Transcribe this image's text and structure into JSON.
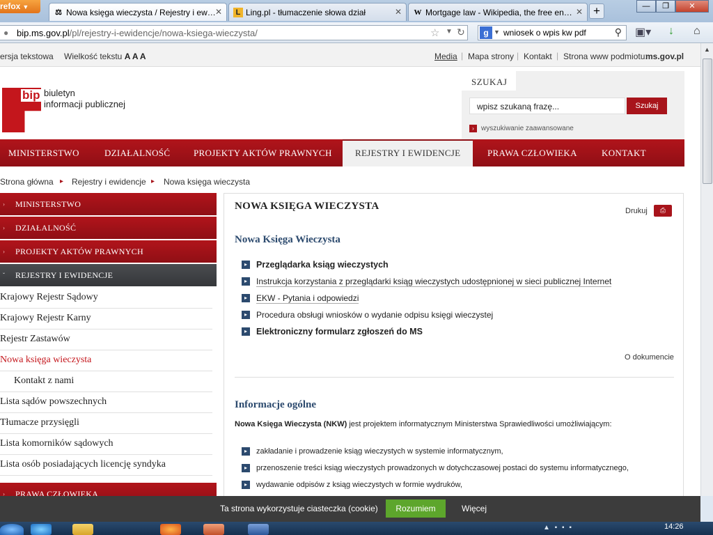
{
  "browser": {
    "menu_button": "refox",
    "tabs": [
      {
        "favicon": "⚖",
        "title": "Nowa księga wieczysta / Rejestry i ew…",
        "active": true
      },
      {
        "favicon": "L",
        "title": "Ling.pl - tłumaczenie słowa dział",
        "active": false
      },
      {
        "favicon": "W",
        "title": "Mortgage law - Wikipedia, the free en…",
        "active": false
      }
    ],
    "new_tab": "+",
    "url": {
      "host": "bip.ms.gov.pl",
      "path": "/pl/rejestry-i-ewidencje/nowa-ksiega-wieczysta/"
    },
    "search_engine": "g",
    "search_query": "wniosek o wpis kw pdf"
  },
  "site": {
    "top": {
      "text_version": "ersja tekstowa",
      "text_size_label": "Wielkość tekstu",
      "text_size_glyphs": "A A A",
      "links": [
        "Media",
        "Mapa strony",
        "Kontakt"
      ],
      "site_label": "Strona www podmiotu:",
      "site_domain": "ms.gov.pl"
    },
    "logo": {
      "mark": "bip",
      "line1": "biuletyn",
      "line2": "informacji publicznej"
    },
    "search": {
      "label": "SZUKAJ",
      "placeholder": "wpisz szukaną frazę...",
      "button": "Szukaj",
      "advanced": "wyszukiwanie zaawansowane"
    },
    "nav": [
      "MINISTERSTWO",
      "DZIAŁALNOŚĆ",
      "PROJEKTY AKTÓW PRAWNYCH",
      "REJESTRY I EWIDENCJE",
      "PRAWA CZŁOWIEKA",
      "KONTAKT"
    ],
    "breadcrumb": [
      "Strona główna",
      "Rejestry i ewidencje",
      "Nowa księga wieczysta"
    ],
    "sidebar": {
      "headers": [
        "MINISTERSTWO",
        "DZIAŁALNOŚĆ",
        "PROJEKTY AKTÓW PRAWNYCH",
        "REJESTRY I EWIDENCJE"
      ],
      "items": [
        "Krajowy Rejestr Sądowy",
        "Krajowy Rejestr Karny",
        "Rejestr Zastawów",
        "Nowa księga wieczysta",
        "Kontakt z nami",
        "Lista sądów powszechnych",
        "Tłumacze przysięgli",
        "Lista komorników sądowych",
        "Lista osób posiadających licencję syndyka"
      ],
      "footer_header": "PRAWA CZŁOWIEKA"
    },
    "content": {
      "title": "NOWA KSIĘGA WIECZYSTA",
      "print": "Drukuj",
      "heading1": "Nowa Księga Wieczysta",
      "links": [
        "Przeglądarka ksiąg wieczystych",
        "Instrukcja korzystania z przeglądarki ksiąg wieczystych udostępnionej w sieci publicznej Internet",
        "EKW - Pytania i odpowiedzi",
        "Procedura obsługi wniosków o wydanie odpisu księgi wieczystej",
        "Elektroniczny formularz zgłoszeń do MS"
      ],
      "about_doc": "O dokumencie",
      "heading2": "Informacje ogólne",
      "intro_bold": "Nowa Księga Wieczysta (NKW)",
      "intro_rest": " jest projektem informatycznym Ministerstwa Sprawiedliwości umożliwiającym:",
      "bullets": [
        "zakładanie i prowadzenie ksiąg wieczystych w systemie informatycznym,",
        "przenoszenie treści ksiąg wieczystych prowadzonych w dotychczasowej postaci do systemu informatycznego,",
        "wydawanie odpisów z ksiąg wieczystych w formie wydruków,"
      ]
    },
    "cookie": {
      "message": "Ta strona wykorzystuje ciasteczka (cookie)",
      "ok": "Rozumiem",
      "more": "Więcej"
    }
  },
  "taskbar": {
    "clock": "14:26"
  },
  "colors": {
    "brand_red": "#b1141b",
    "nav_blue": "#2c4a6e",
    "cookie_ok": "#5da62c"
  }
}
